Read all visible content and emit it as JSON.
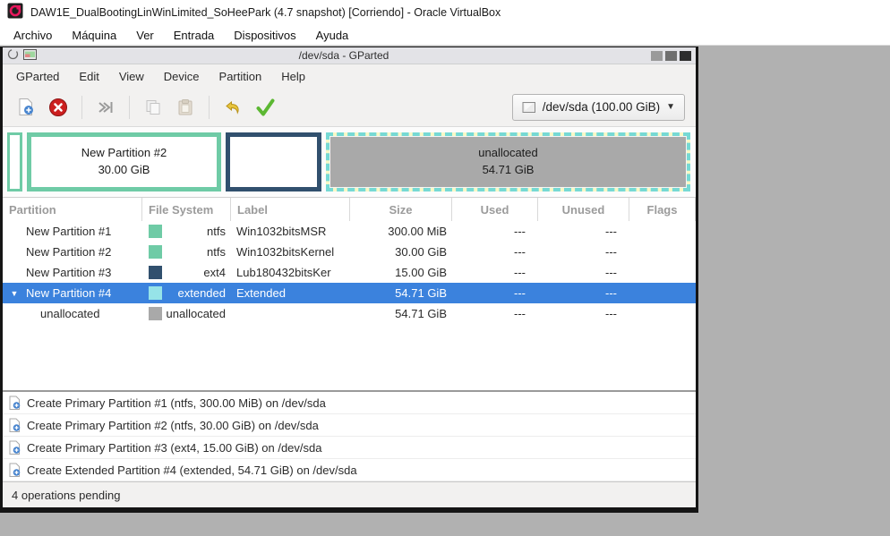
{
  "vbox": {
    "title": "DAW1E_DualBootingLinWinLimited_SoHeePark (4.7 snapshot) [Corriendo] - Oracle VirtualBox",
    "menu": [
      "Archivo",
      "Máquina",
      "Ver",
      "Entrada",
      "Dispositivos",
      "Ayuda"
    ]
  },
  "gparted": {
    "title": "/dev/sda - GParted",
    "menu": [
      "GParted",
      "Edit",
      "View",
      "Device",
      "Partition",
      "Help"
    ],
    "toolbar": {
      "device_selector": "/dev/sda (100.00 GiB)"
    },
    "visual": {
      "p2": {
        "line1": "New Partition #2",
        "line2": "30.00 GiB"
      },
      "ext": {
        "line1": "unallocated",
        "line2": "54.71 GiB"
      }
    },
    "colors": {
      "ntfs": "#6fcba6",
      "ext4": "#31506e",
      "extended": "#96e3e8",
      "unallocated": "#a9a9a9",
      "selection": "#3b82dd"
    },
    "table": {
      "columns": [
        "Partition",
        "File System",
        "Label",
        "Size",
        "Used",
        "Unused",
        "Flags"
      ],
      "rows": [
        {
          "partition": "New Partition #1",
          "fs": "ntfs",
          "fs_color": "#6fcba6",
          "label": "Win1032bitsMSR",
          "size": "300.00 MiB",
          "used": "---",
          "unused": "---",
          "flags": ""
        },
        {
          "partition": "New Partition #2",
          "fs": "ntfs",
          "fs_color": "#6fcba6",
          "label": "Win1032bitsKernel",
          "size": "30.00 GiB",
          "used": "---",
          "unused": "---",
          "flags": ""
        },
        {
          "partition": "New Partition #3",
          "fs": "ext4",
          "fs_color": "#31506e",
          "label": "Lub180432bitsKer",
          "size": "15.00 GiB",
          "used": "---",
          "unused": "---",
          "flags": ""
        },
        {
          "partition": "New Partition #4",
          "fs": "extended",
          "fs_color": "#96e3e8",
          "label": "Extended",
          "size": "54.71 GiB",
          "used": "---",
          "unused": "---",
          "flags": "",
          "expander": "▼"
        },
        {
          "partition": "unallocated",
          "fs": "unallocated",
          "fs_color": "#a9a9a9",
          "label": "",
          "size": "54.71 GiB",
          "used": "---",
          "unused": "---",
          "flags": ""
        }
      ]
    },
    "operations": [
      "Create Primary Partition #1 (ntfs, 300.00 MiB) on /dev/sda",
      "Create Primary Partition #2 (ntfs, 30.00 GiB) on /dev/sda",
      "Create Primary Partition #3 (ext4, 15.00 GiB) on /dev/sda",
      "Create Extended Partition #4 (extended, 54.71 GiB) on /dev/sda"
    ],
    "statusbar": "4 operations pending"
  }
}
